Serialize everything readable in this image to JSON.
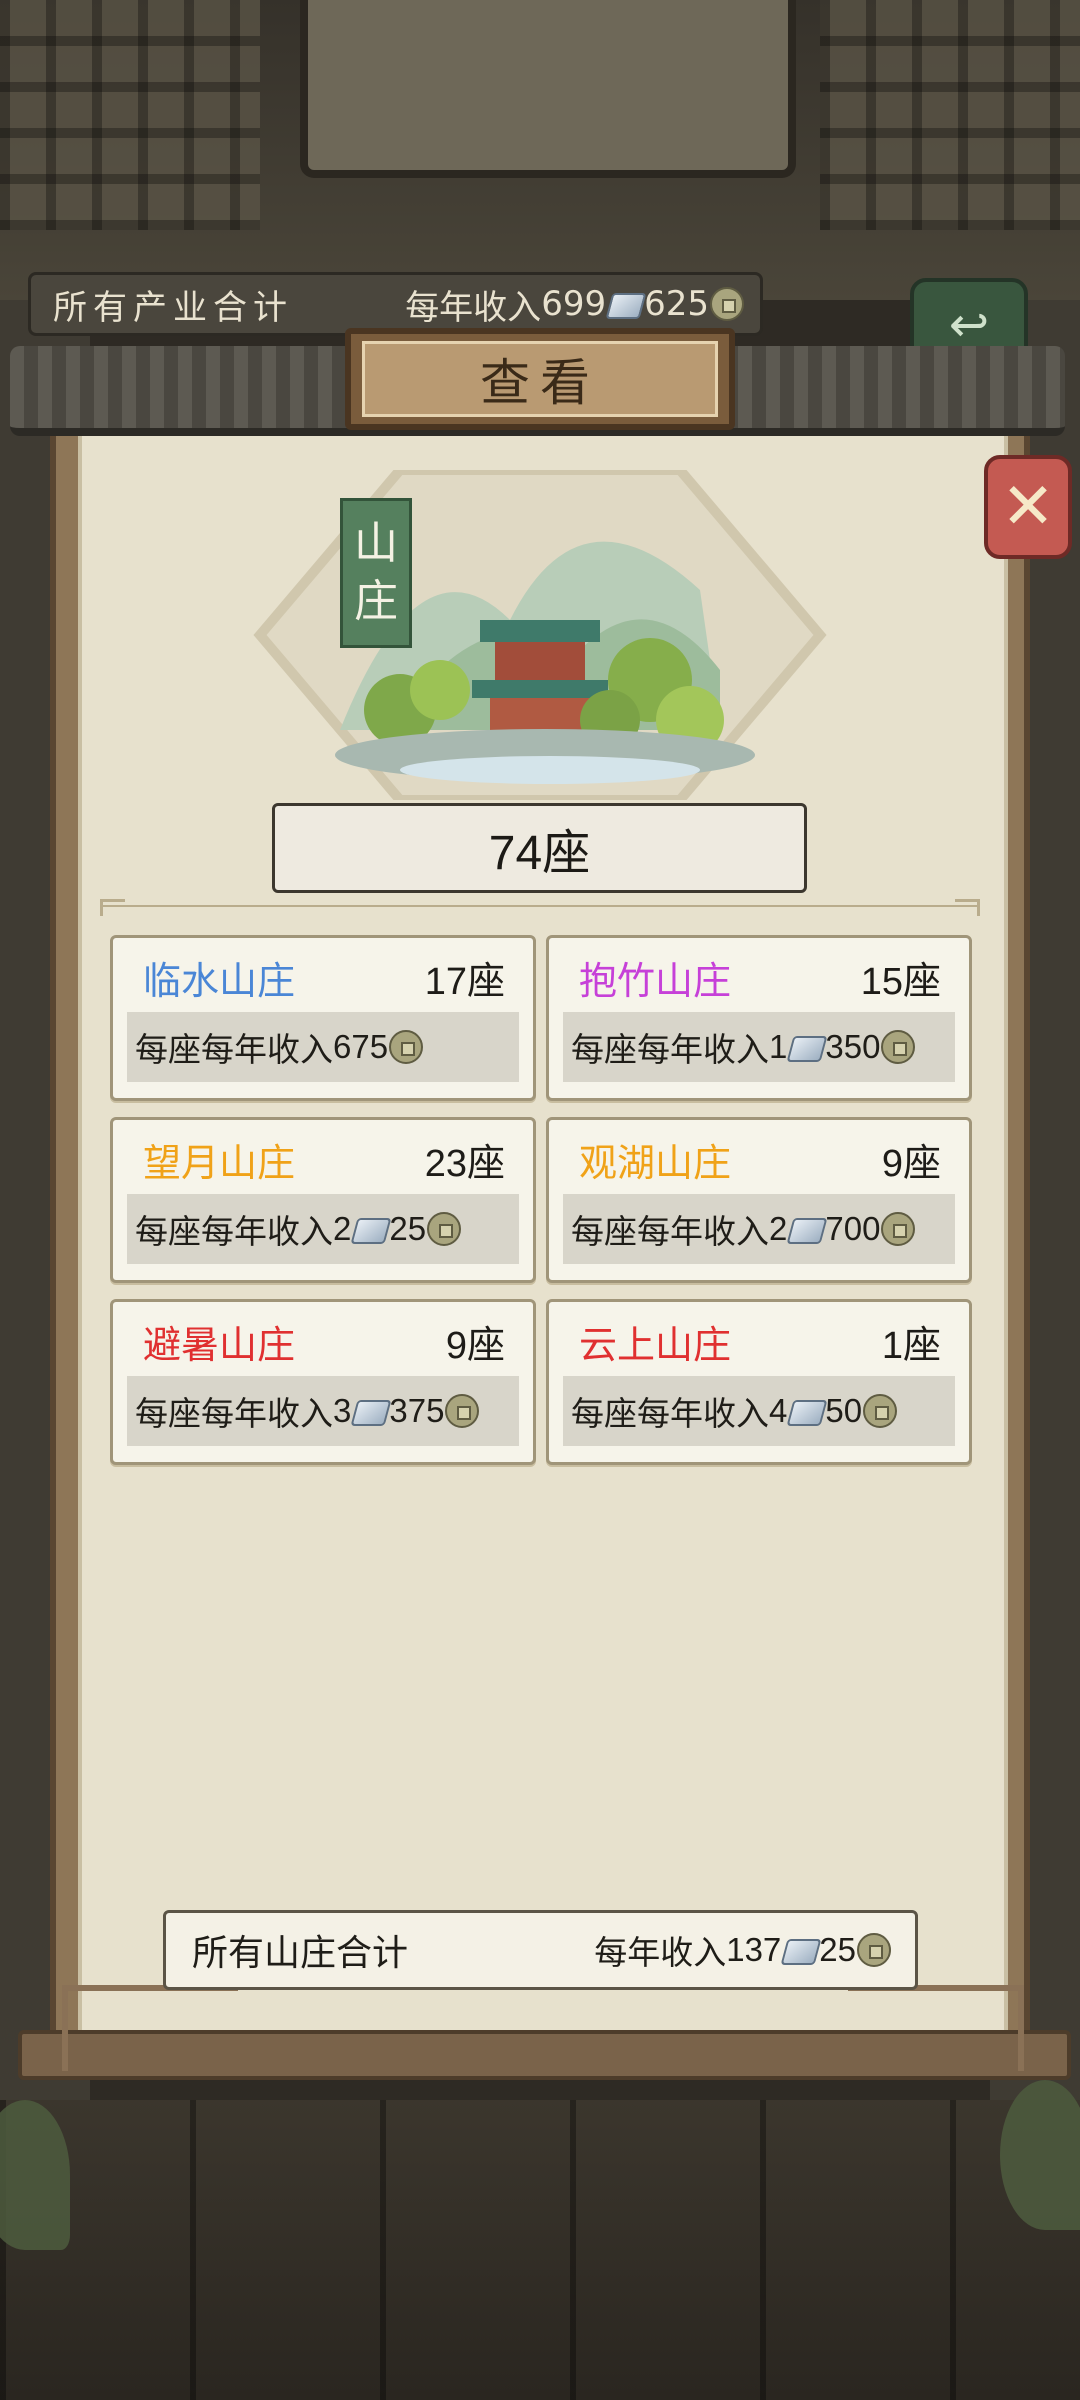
{
  "header": {
    "all_industry_label": "所有产业合计",
    "annual_income_label": "每年收入",
    "silver": "699",
    "coins": "625"
  },
  "dialog": {
    "title": "查看",
    "category_tag": [
      "山",
      "庄"
    ],
    "total_count": "74座"
  },
  "villas": [
    {
      "name": "临水山庄",
      "count": "17座",
      "income_label": "每座每年收入",
      "silver": "",
      "coins": "675",
      "color": "#4a86d6"
    },
    {
      "name": "抱竹山庄",
      "count": "15座",
      "income_label": "每座每年收入",
      "silver": "1",
      "coins": "350",
      "color": "#c640d8"
    },
    {
      "name": "望月山庄",
      "count": "23座",
      "income_label": "每座每年收入",
      "silver": "2",
      "coins": "25",
      "color": "#f0a218"
    },
    {
      "name": "观湖山庄",
      "count": "9座",
      "income_label": "每座每年收入",
      "silver": "2",
      "coins": "700",
      "color": "#f0a218"
    },
    {
      "name": "避暑山庄",
      "count": "9座",
      "income_label": "每座每年收入",
      "silver": "3",
      "coins": "375",
      "color": "#e03030"
    },
    {
      "name": "云上山庄",
      "count": "1座",
      "income_label": "每座每年收入",
      "silver": "4",
      "coins": "50",
      "color": "#e03030"
    }
  ],
  "total": {
    "label": "所有山庄合计",
    "annual_income_label": "每年收入",
    "silver": "137",
    "coins": "25"
  },
  "icons": {
    "silver": "silver-ingot-icon",
    "coin": "copper-coin-icon",
    "close": "close-icon",
    "back": "back-arrow-icon"
  }
}
